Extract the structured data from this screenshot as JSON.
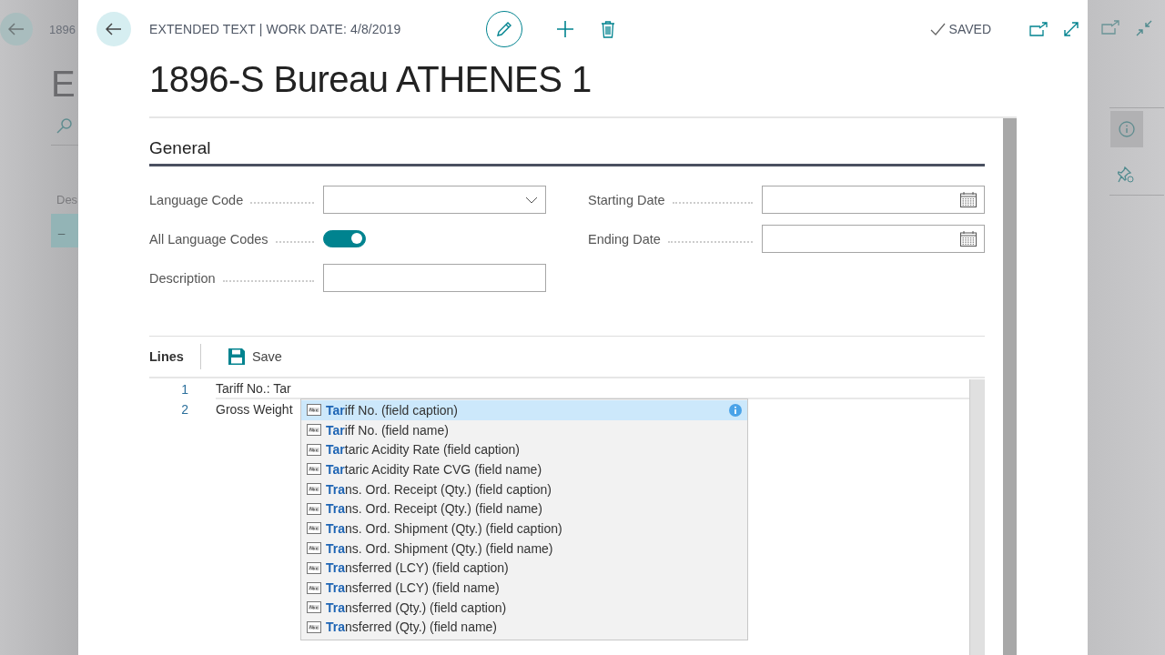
{
  "background": {
    "breadcrumb": "1896",
    "title": "E",
    "column_header": "Des",
    "row_cell": "_"
  },
  "dialog": {
    "caption": "EXTENDED TEXT | WORK DATE: 4/8/2019",
    "status": "SAVED",
    "title": "1896-S Bureau ATHENES 1"
  },
  "general": {
    "heading": "General",
    "left_fields": [
      {
        "kind": "dropdown",
        "label": "Language Code"
      },
      {
        "kind": "toggle",
        "label": "All Language Codes",
        "on": true
      },
      {
        "kind": "text",
        "label": "Description"
      }
    ],
    "right_fields": [
      {
        "kind": "date",
        "label": "Starting Date"
      },
      {
        "kind": "date",
        "label": "Ending Date"
      }
    ]
  },
  "lines": {
    "title": "Lines",
    "save": "Save",
    "rows": [
      {
        "number": "1",
        "text": "Tariff No.: Tar",
        "selected": true
      },
      {
        "number": "2",
        "text": "Gross Weight",
        "selected": false
      }
    ],
    "suggestions": [
      {
        "text": "**Tar**iff No. (field caption)",
        "selected": true
      },
      {
        "text": "**Tar**iff No. (field name)",
        "selected": false
      },
      {
        "text": "**Tar**taric Acidity Rate (field caption)",
        "selected": false
      },
      {
        "text": "**Tar**taric Acidity Rate CVG (field name)",
        "selected": false
      },
      {
        "text": "**Tra**ns. Ord. Receipt (Qty.) (field caption)",
        "selected": false
      },
      {
        "text": "**Tra**ns. Ord. Receipt (Qty.) (field name)",
        "selected": false
      },
      {
        "text": "**Tra**ns. Ord. Shipment (Qty.) (field caption)",
        "selected": false
      },
      {
        "text": "**Tra**ns. Ord. Shipment (Qty.) (field name)",
        "selected": false
      },
      {
        "text": "**Tra**nsferred (LCY) (field caption)",
        "selected": false
      },
      {
        "text": "**Tra**nsferred (LCY) (field name)",
        "selected": false
      },
      {
        "text": "**Tra**nsferred (Qty.) (field caption)",
        "selected": false
      },
      {
        "text": "**Tra**nsferred (Qty.) (field name)",
        "selected": false
      }
    ]
  }
}
